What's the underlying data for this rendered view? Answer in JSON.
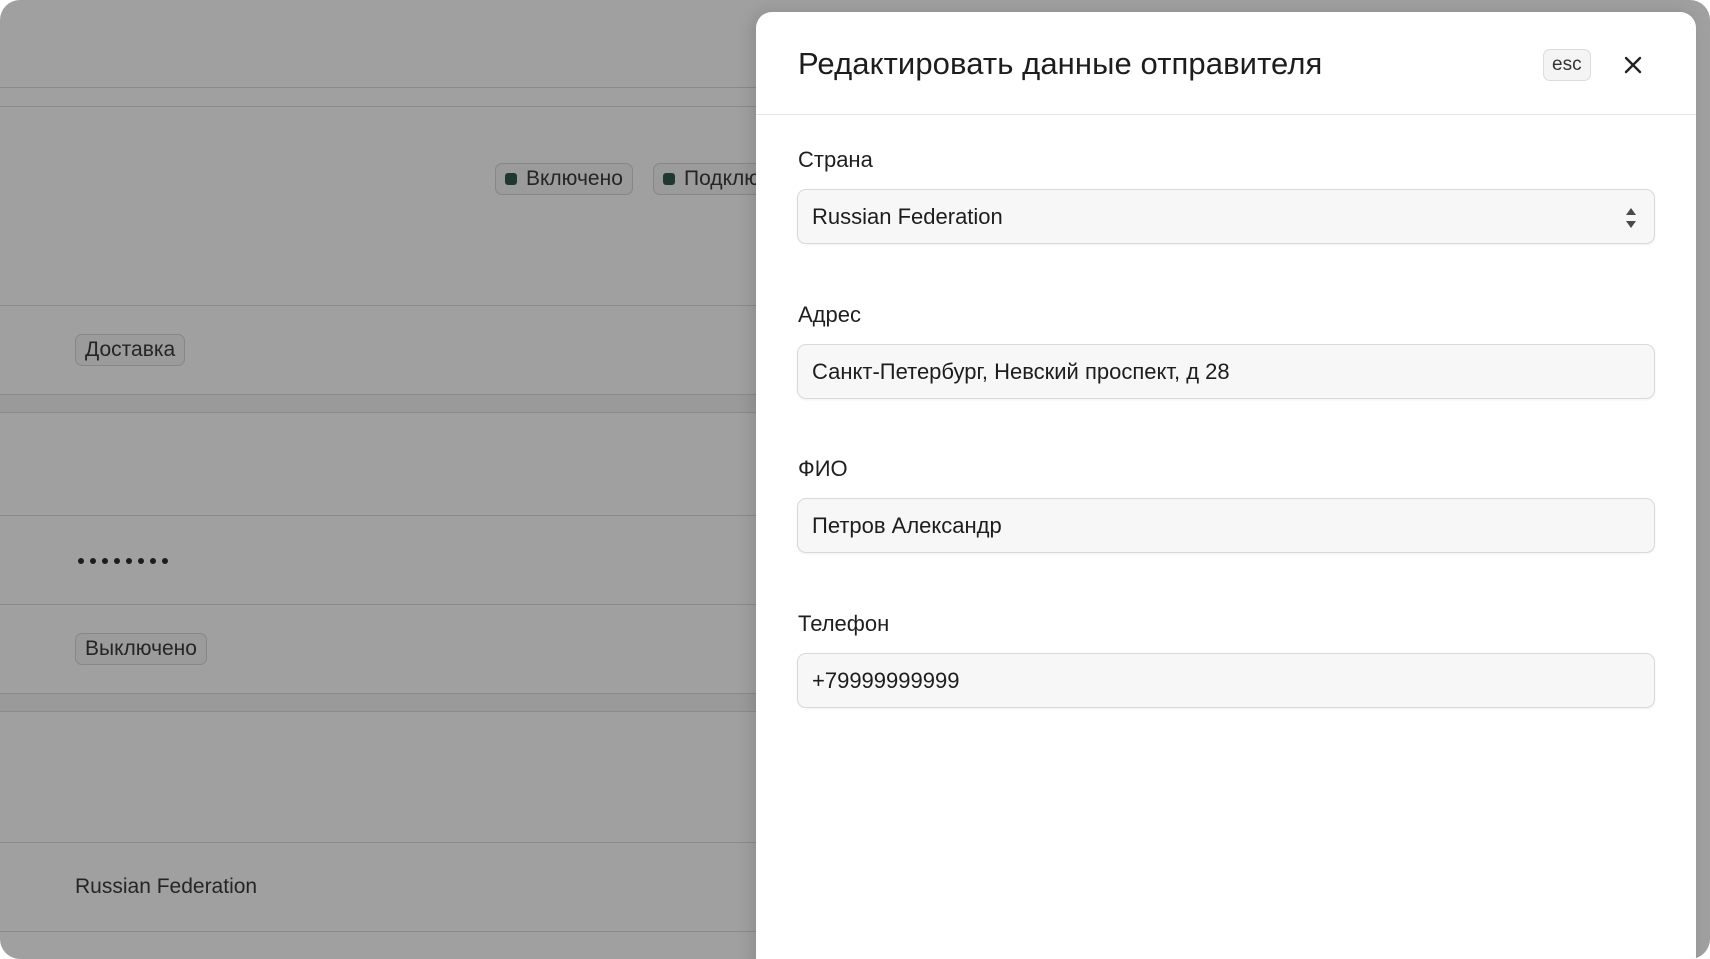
{
  "background": {
    "badge_enabled": "Включено",
    "badge_connected": "Подклю",
    "badge_delivery": "Доставка",
    "badge_disabled": "Выключено",
    "country_text": "Russian Federation"
  },
  "drawer": {
    "title": "Редактировать данные отправителя",
    "esc_label": "esc",
    "close_icon": "close-icon",
    "fields": [
      {
        "label": "Страна",
        "value": "Russian Federation",
        "type": "select"
      },
      {
        "label": "Адрес",
        "value": "Санкт-Петербург, Невский проспект, д 28",
        "type": "text"
      },
      {
        "label": "ФИО",
        "value": "Петров Александр",
        "type": "text"
      },
      {
        "label": "Телефон",
        "value": "+79999999999",
        "type": "text"
      }
    ]
  },
  "colors": {
    "status_dot": "#2f5a4d",
    "overlay": "rgba(0,0,0,0.36)"
  }
}
